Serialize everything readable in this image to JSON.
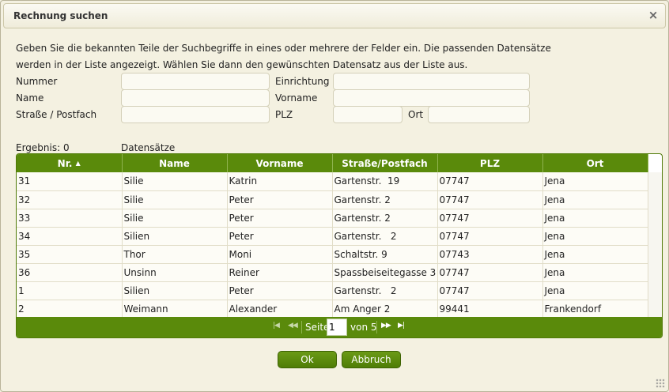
{
  "dialog": {
    "title": "Rechnung suchen",
    "close_icon": "×"
  },
  "intro": "Geben Sie die bekannten Teile der Suchbegriffe in eines oder mehrere der Felder ein. Die passenden Datensätze werden in der Liste angezeigt. Wählen Sie dann den gewünschten Datensatz aus der Liste aus.",
  "form": {
    "nummer_label": "Nummer",
    "nummer_value": "",
    "einrichtung_label": "Einrichtung",
    "einrichtung_value": "",
    "name_label": "Name",
    "name_value": "",
    "vorname_label": "Vorname",
    "vorname_value": "",
    "strasse_label": "Straße / Postfach",
    "strasse_value": "",
    "plz_label": "PLZ",
    "plz_value": "",
    "ort_label": "Ort",
    "ort_value": ""
  },
  "result": {
    "label": "Ergebnis: 0",
    "suffix": "Datensätze"
  },
  "grid": {
    "columns": [
      "Nr.",
      "Name",
      "Vorname",
      "Straße/Postfach",
      "PLZ",
      "Ort"
    ],
    "sort_icon": "sort-asc-icon",
    "rows": [
      [
        "31",
        "Silie",
        "Katrin",
        "Gartenstr.  19",
        "07747",
        "Jena"
      ],
      [
        "32",
        "Silie",
        "Peter",
        "Gartenstr. 2",
        "07747",
        "Jena"
      ],
      [
        "33",
        "Silie",
        "Peter",
        "Gartenstr. 2",
        "07747",
        "Jena"
      ],
      [
        "34",
        "Silien",
        "Peter",
        "Gartenstr.   2",
        "07747",
        "Jena"
      ],
      [
        "35",
        "Thor",
        "Moni",
        "Schaltstr. 9",
        "07743",
        "Jena"
      ],
      [
        "36",
        "Unsinn",
        "Reiner",
        "Spassbeiseitegasse 3",
        "07747",
        "Jena"
      ],
      [
        "1",
        "Silien",
        "Peter",
        "Gartenstr.   2",
        "07747",
        "Jena"
      ],
      [
        "2",
        "Weimann",
        "Alexander",
        "Am Anger 2",
        "99441",
        "Frankendorf"
      ]
    ]
  },
  "pager": {
    "page_label": "Seite",
    "page_value": "1",
    "of_label": "von 5"
  },
  "buttons": {
    "ok": "Ok",
    "cancel": "Abbruch"
  },
  "colors": {
    "accent": "#5a8a0b",
    "background": "#f4f1e1"
  }
}
